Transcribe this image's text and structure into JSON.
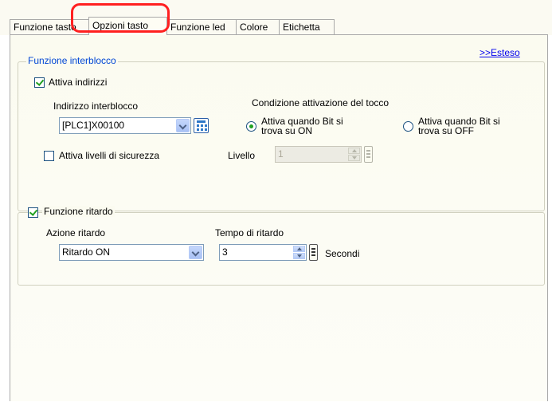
{
  "tabs": [
    {
      "label": "Funzione tasto",
      "active": false
    },
    {
      "label": "Opzioni tasto",
      "active": true
    },
    {
      "label": "Funzione led",
      "active": false
    },
    {
      "label": "Colore",
      "active": false
    },
    {
      "label": "Etichetta",
      "active": false
    }
  ],
  "extended_link": ">>Esteso",
  "interlock": {
    "legend": "Funzione interblocco",
    "enable_address_label": "Attiva indirizzi",
    "enable_address_checked": true,
    "address_label": "Indirizzo interblocco",
    "address_value": "[PLC1]X00100",
    "condition_label": "Condizione attivazione del tocco",
    "radio_on_label_1": "Attiva quando Bit si",
    "radio_on_label_2": "trova su ON",
    "radio_on_selected": true,
    "radio_off_label_1": "Attiva quando Bit si",
    "radio_off_label_2": "trova su OFF",
    "radio_off_selected": false,
    "security_label": "Attiva livelli di sicurezza",
    "security_checked": false,
    "level_label": "Livello",
    "level_value": "1"
  },
  "delay": {
    "legend": "Funzione ritardo",
    "enabled": true,
    "action_label": "Azione ritardo",
    "action_value": "Ritardo ON",
    "time_label": "Tempo di ritardo",
    "time_value": "3",
    "unit_label": "Secondi"
  },
  "colors": {
    "highlight": "#ff2020",
    "legend_blue": "#0046d5",
    "check_green": "#21a121"
  }
}
